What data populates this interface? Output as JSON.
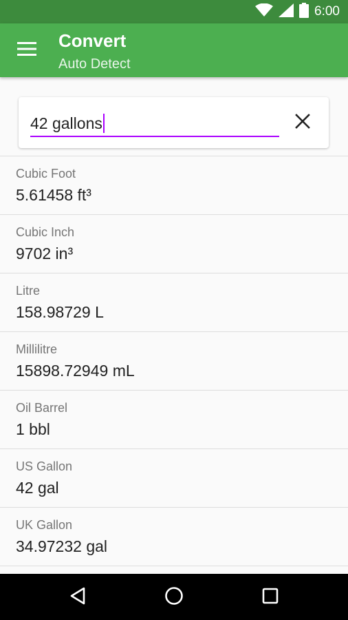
{
  "status_bar": {
    "time": "6:00",
    "icons": [
      "wifi-icon",
      "signal-icon",
      "battery-icon"
    ]
  },
  "app_bar": {
    "menu_icon": "menu-icon",
    "title": "Convert",
    "subtitle": "Auto Detect",
    "color": "#4CAF50"
  },
  "search": {
    "value": "42 gallons",
    "clear_icon": "close-icon",
    "accent_color": "#AA00FF"
  },
  "results": [
    {
      "label": "Cubic Foot",
      "value": "5.61458 ft³"
    },
    {
      "label": "Cubic Inch",
      "value": "9702 in³"
    },
    {
      "label": "Litre",
      "value": "158.98729 L"
    },
    {
      "label": "Millilitre",
      "value": "15898.72949 mL"
    },
    {
      "label": "Oil Barrel",
      "value": "1 bbl"
    },
    {
      "label": "US Gallon",
      "value": "42 gal"
    },
    {
      "label": "UK Gallon",
      "value": "34.97232 gal"
    }
  ],
  "nav_bar": {
    "icons": [
      "back-icon",
      "home-icon",
      "recents-icon"
    ]
  }
}
